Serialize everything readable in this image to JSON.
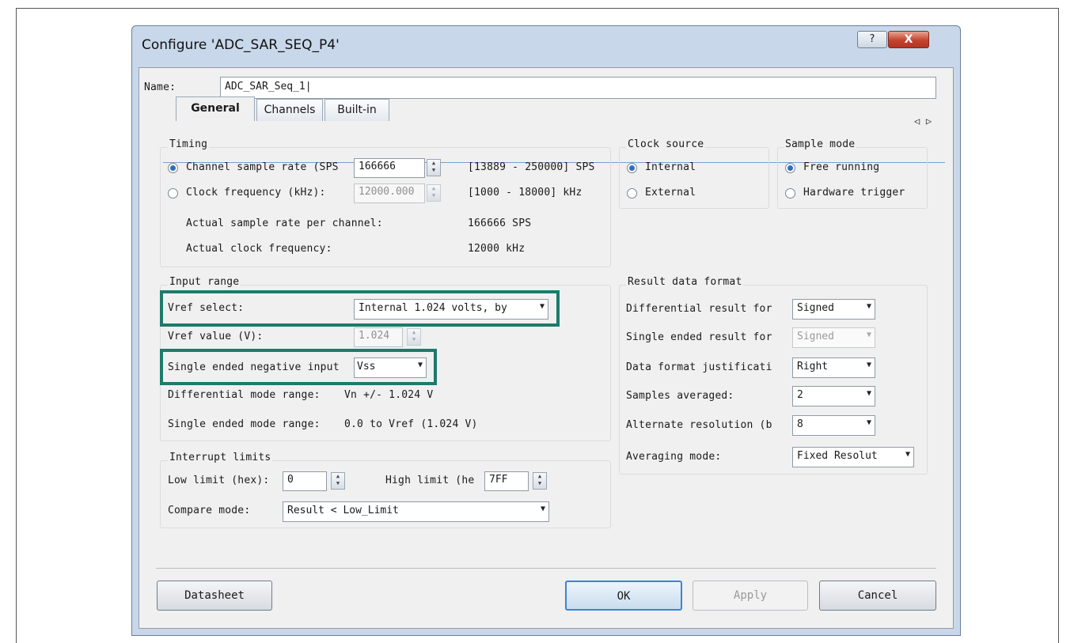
{
  "window": {
    "title": "Configure 'ADC_SAR_SEQ_P4'",
    "help_label": "?",
    "close_label": "X"
  },
  "name_field": {
    "label": "Name:",
    "value": "ADC_SAR_Seq_1|"
  },
  "tabs": [
    {
      "label": "General",
      "active": true
    },
    {
      "label": "Channels",
      "active": false
    },
    {
      "label": "Built-in",
      "active": false
    }
  ],
  "tab_scroll": "◁ ▷",
  "timing": {
    "title": "Timing",
    "channel_rate_label": "Channel sample rate (SPS",
    "channel_rate_value": "166666",
    "channel_rate_range": "[13889 - 250000] SPS",
    "clock_freq_label": "Clock frequency (kHz):",
    "clock_freq_value": "12000.000",
    "clock_freq_range": "[1000 - 18000] kHz",
    "actual_rate_label": "Actual sample rate per channel:",
    "actual_rate_value": "166666 SPS",
    "actual_clock_label": "Actual clock frequency:",
    "actual_clock_value": "12000 kHz"
  },
  "clock_source": {
    "title": "Clock source",
    "internal": "Internal",
    "external": "External"
  },
  "sample_mode": {
    "title": "Sample mode",
    "free": "Free running",
    "hw": "Hardware trigger"
  },
  "input_range": {
    "title": "Input range",
    "vref_select_label": "Vref select:",
    "vref_select_value": "Internal 1.024 volts, by",
    "vref_value_label": "Vref value (V):",
    "vref_value": "1.024",
    "neg_input_label": "Single ended negative input",
    "neg_input_value": "Vss",
    "diff_range_label": "Differential mode range:",
    "diff_range_value": "Vn +/- 1.024 V",
    "se_range_label": "Single ended mode range:",
    "se_range_value": "0.0 to Vref (1.024 V)"
  },
  "result_format": {
    "title": "Result data format",
    "diff_label": "Differential result for",
    "diff_value": "Signed",
    "se_label": "Single ended result for",
    "se_value": "Signed",
    "just_label": "Data format justificati",
    "just_value": "Right",
    "avg_label": "Samples averaged:",
    "avg_value": "2",
    "alt_label": "Alternate resolution (b",
    "alt_value": "8",
    "avg_mode_label": "Averaging mode:",
    "avg_mode_value": "Fixed Resolut"
  },
  "interrupt": {
    "title": "Interrupt limits",
    "low_label": "Low limit (hex):",
    "low_value": "0",
    "high_label": "High limit (he",
    "high_value": "7FF",
    "compare_label": "Compare mode:",
    "compare_value": "Result < Low_Limit"
  },
  "buttons": {
    "datasheet": "Datasheet",
    "ok": "OK",
    "apply": "Apply",
    "cancel": "Cancel"
  },
  "colors": {
    "highlight": "#1e7a6a",
    "radio_selected": "#2d6fbf",
    "title_bar": "#c8d8ea"
  }
}
